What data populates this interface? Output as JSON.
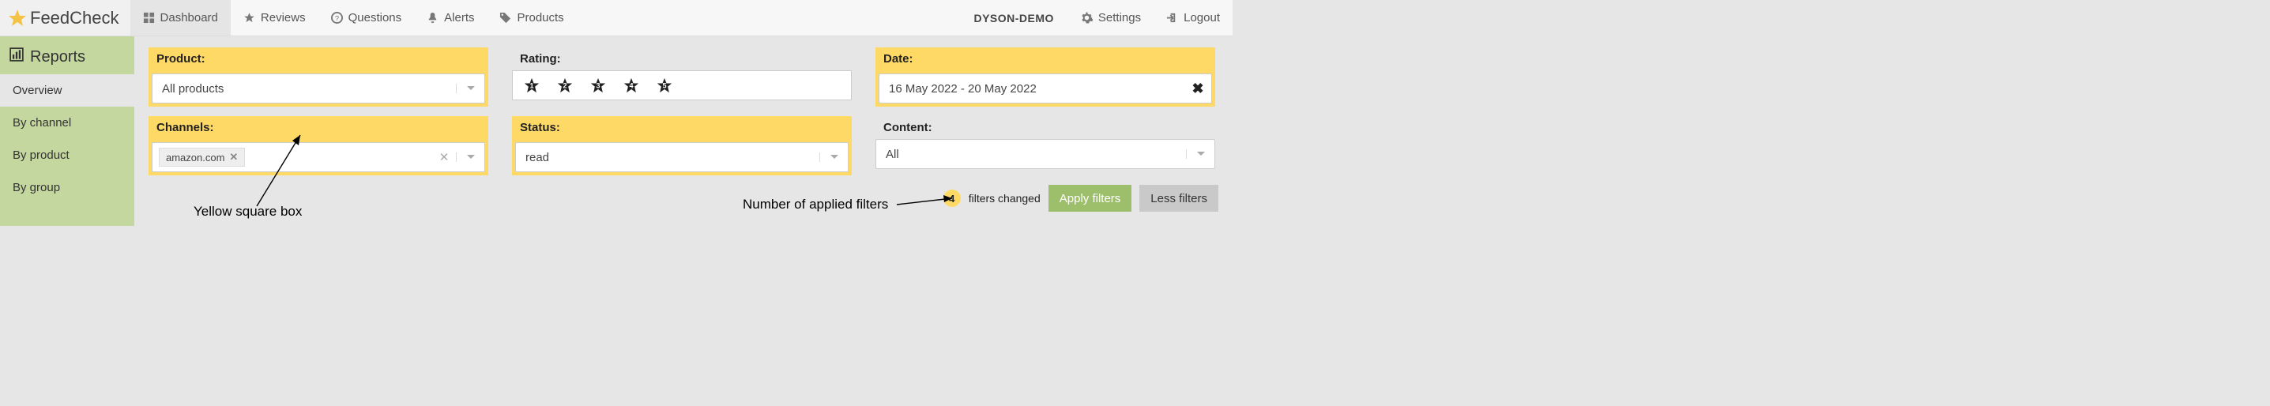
{
  "brand": "FeedCheck",
  "nav": {
    "dashboard": "Dashboard",
    "reviews": "Reviews",
    "questions": "Questions",
    "alerts": "Alerts",
    "products": "Products",
    "user": "DYSON-DEMO",
    "settings": "Settings",
    "logout": "Logout"
  },
  "sidebar": {
    "title": "Reports",
    "items": {
      "overview": "Overview",
      "by_channel": "By channel",
      "by_product": "By product",
      "by_group": "By group"
    }
  },
  "filters": {
    "product": {
      "label": "Product:",
      "value": "All products"
    },
    "rating": {
      "label": "Rating:",
      "stars": [
        "1",
        "2",
        "3",
        "4",
        "5"
      ]
    },
    "date": {
      "label": "Date:",
      "value": "16 May 2022 - 20 May 2022"
    },
    "channels": {
      "label": "Channels:",
      "chip": "amazon.com"
    },
    "status": {
      "label": "Status:",
      "value": "read"
    },
    "content": {
      "label": "Content:",
      "value": "All"
    }
  },
  "actions": {
    "count": "4",
    "changed_text": "filters changed",
    "apply": "Apply filters",
    "less": "Less filters"
  },
  "annotations": {
    "yellow_box": "Yellow square box",
    "num_applied": "Number of applied filters"
  }
}
